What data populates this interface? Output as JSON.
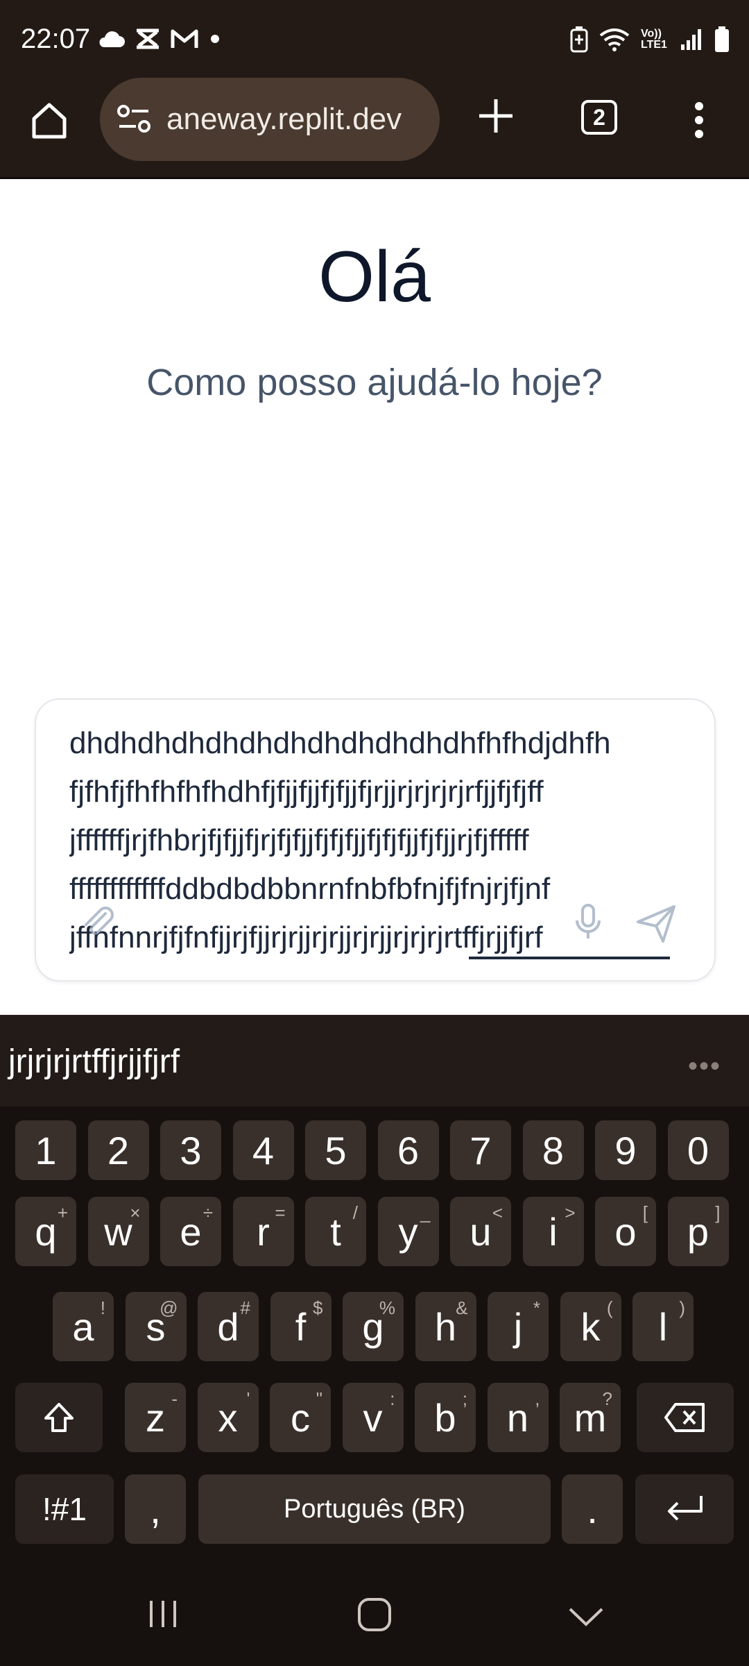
{
  "status_bar": {
    "time": "22:07",
    "left_icons": [
      "cloud-icon",
      "capcut-icon",
      "gmail-icon",
      "dot-icon"
    ],
    "right_icons": [
      "battery-saver-icon",
      "wifi-icon",
      "volte-icon",
      "signal-icon",
      "battery-icon"
    ],
    "volte_label": "Vo)) LTE1"
  },
  "browser": {
    "url": "aneway.replit.dev",
    "tab_count": "2"
  },
  "page": {
    "title": "Olá",
    "subtitle": "Como posso ajudá-lo hoje?"
  },
  "composer": {
    "lines": [
      "dhdhdhdhdhdhdhdhdhdhdhdhfhfhdjdhfh",
      "fjfhfjfhfhfhfhdhfjfjjfjjfjfjjfjrjjrjrjrjrjrfjjfjfjff",
      "jffffffjrjfhbrjfjfjjfjrjfjfjjfjfjfjjfjfjfjjfjfjjrjfjfffff",
      "ffffffffffffddbdbdbbnrnfnbfbfnjfjfnjrjfjnf",
      "jffnfnnrjfjfnfjjrjfjjrjrjjrjrjjrjrjjrjrjrjrtffjrjjfjrf"
    ]
  },
  "keyboard": {
    "suggestion": "jrjrjrjrtffjrjjfjrf",
    "number_row": [
      "1",
      "2",
      "3",
      "4",
      "5",
      "6",
      "7",
      "8",
      "9",
      "0"
    ],
    "row1": [
      {
        "k": "q",
        "h": "+"
      },
      {
        "k": "w",
        "h": "×"
      },
      {
        "k": "e",
        "h": "÷"
      },
      {
        "k": "r",
        "h": "="
      },
      {
        "k": "t",
        "h": "/"
      },
      {
        "k": "y",
        "h": "_"
      },
      {
        "k": "u",
        "h": "<"
      },
      {
        "k": "i",
        "h": ">"
      },
      {
        "k": "o",
        "h": "["
      },
      {
        "k": "p",
        "h": "]"
      }
    ],
    "row2": [
      {
        "k": "a",
        "h": "!"
      },
      {
        "k": "s",
        "h": "@"
      },
      {
        "k": "d",
        "h": "#"
      },
      {
        "k": "f",
        "h": "$"
      },
      {
        "k": "g",
        "h": "%"
      },
      {
        "k": "h",
        "h": "&"
      },
      {
        "k": "j",
        "h": "*"
      },
      {
        "k": "k",
        "h": "("
      },
      {
        "k": "l",
        "h": ")"
      }
    ],
    "row3": [
      {
        "k": "z",
        "h": "-"
      },
      {
        "k": "x",
        "h": "'"
      },
      {
        "k": "c",
        "h": "\""
      },
      {
        "k": "v",
        "h": ":"
      },
      {
        "k": "b",
        "h": ";"
      },
      {
        "k": "n",
        "h": ","
      },
      {
        "k": "m",
        "h": "?"
      }
    ],
    "symbols_label": "!#1",
    "comma_label": ",",
    "space_label": "Português (BR)",
    "period_label": "."
  },
  "colors": {
    "chrome_bg": "#231a15",
    "url_pill": "#4a3a30",
    "keyboard_bg": "#16110f",
    "key_bg": "#3a302b",
    "title_text": "#0f172a",
    "subtitle_text": "#475569"
  }
}
